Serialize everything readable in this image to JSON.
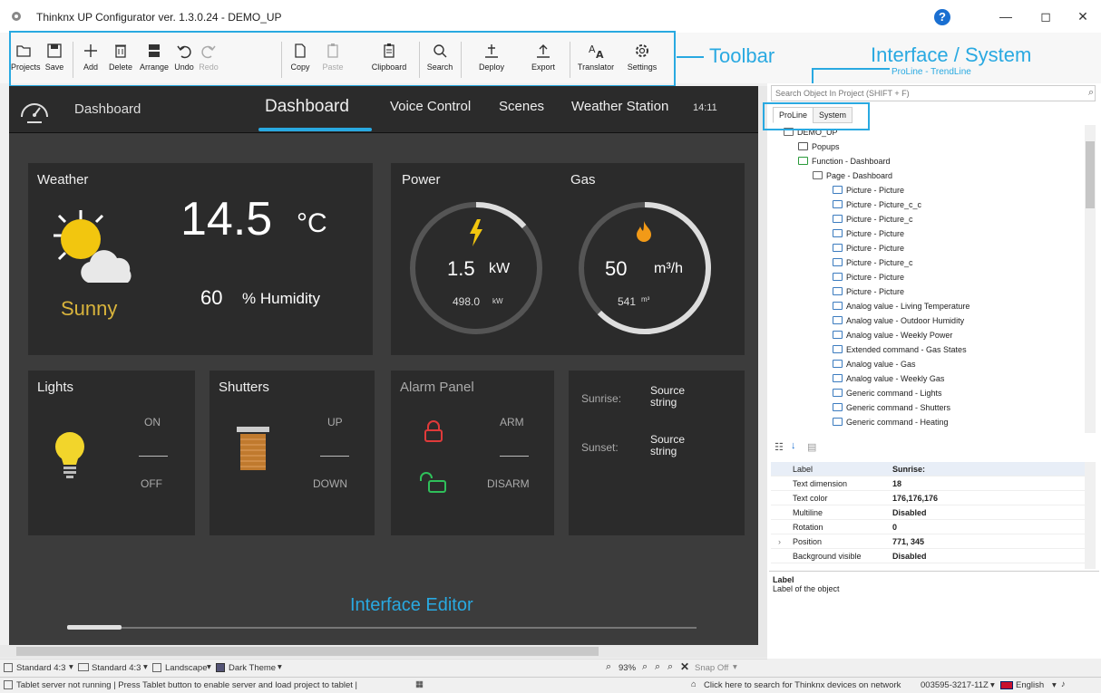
{
  "window": {
    "title": "Thinknx UP Configurator ver. 1.3.0.24 - DEMO_UP",
    "help": "?",
    "minimize": "—",
    "maximize": "◻",
    "close": "✕"
  },
  "toolbar": {
    "items": [
      {
        "label": "Projects",
        "icon": "folder-icon"
      },
      {
        "label": "Save",
        "icon": "save-icon"
      },
      {
        "label": "Add",
        "icon": "plus-icon"
      },
      {
        "label": "Delete",
        "icon": "trash-icon"
      },
      {
        "label": "Arrange",
        "icon": "arrange-icon"
      },
      {
        "label": "Undo",
        "icon": "undo-icon"
      },
      {
        "label": "Redo",
        "icon": "redo-icon"
      },
      {
        "label": "Copy",
        "icon": "copy-icon"
      },
      {
        "label": "Paste",
        "icon": "paste-icon"
      },
      {
        "label": "Clipboard",
        "icon": "clipboard-icon"
      },
      {
        "label": "Search",
        "icon": "search-icon"
      },
      {
        "label": "Deploy",
        "icon": "deploy-icon"
      },
      {
        "label": "Export",
        "icon": "export-icon"
      },
      {
        "label": "Translator",
        "icon": "translator-icon"
      },
      {
        "label": "Settings",
        "icon": "gear-icon"
      }
    ]
  },
  "annotations": {
    "toolbar": "Toolbar",
    "interface_system": "Interface / System",
    "proline_trendline": "ProLine - TrendLine",
    "interface_editor": "Interface Editor"
  },
  "editor": {
    "nav_left": "Dashboard",
    "tabs": [
      "Dashboard",
      "Voice Control",
      "Scenes",
      "Weather Station"
    ],
    "time": "14:11",
    "weather": {
      "title": "Weather",
      "temp": "14.5",
      "unit": "°C",
      "condition": "Sunny",
      "humidity_value": "60",
      "humidity_label": "% Humidity"
    },
    "power": {
      "title": "Power",
      "value": "1.5",
      "unit": "kW",
      "total": "498.0",
      "total_unit": "kW"
    },
    "gas": {
      "title": "Gas",
      "value": "50",
      "unit": "m³/h",
      "total": "541",
      "total_unit": "m³"
    },
    "lights": {
      "title": "Lights",
      "on": "ON",
      "off": "OFF"
    },
    "shutters": {
      "title": "Shutters",
      "up": "UP",
      "down": "DOWN"
    },
    "alarm": {
      "title": "Alarm Panel",
      "arm": "ARM",
      "disarm": "DISARM"
    },
    "sun": {
      "sunrise": "Sunrise:",
      "sunset": "Sunset:",
      "sunrise_value": "Source string",
      "sunset_value": "Source string"
    }
  },
  "status1": {
    "resolution1": "Standard 4:3",
    "resolution2": "Standard 4:3",
    "orientation": "Landscape",
    "theme": "Dark Theme",
    "zoom": "93%",
    "snap": "Snap Off"
  },
  "status2": {
    "left": "Tablet server not running | Press Tablet button to enable server and load project to tablet |",
    "right": "Click here to search for Thinknx devices on network",
    "serial": "003595-3217-11Z",
    "language": "English"
  },
  "panel": {
    "search_placeholder": "Search Object In Project (SHIFT + F)",
    "tabs": [
      "ProLine",
      "System"
    ],
    "tree": [
      "DEMO_UP",
      "Popups",
      "Function - Dashboard",
      "Page - Dashboard",
      "Picture - Picture",
      "Picture - Picture_c_c",
      "Picture - Picture_c",
      "Picture - Picture",
      "Picture - Picture",
      "Picture - Picture_c",
      "Picture - Picture",
      "Picture - Picture",
      "Analog value - Living Temperature",
      "Analog value - Outdoor Humidity",
      "Analog value - Weekly Power",
      "Extended command - Gas States",
      "Analog value - Gas",
      "Analog value - Weekly Gas",
      "Generic command - Lights",
      "Generic command - Shutters",
      "Generic command - Heating"
    ],
    "props": [
      {
        "k": "Label",
        "v": "Sunrise:"
      },
      {
        "k": "Text dimension",
        "v": "18"
      },
      {
        "k": "Text color",
        "v": "176,176,176"
      },
      {
        "k": "Multiline",
        "v": "Disabled"
      },
      {
        "k": "Rotation",
        "v": "0"
      },
      {
        "k": "Position",
        "v": "771, 345"
      },
      {
        "k": "Background visible",
        "v": "Disabled"
      }
    ],
    "desc_title": "Label",
    "desc": "Label of the object"
  }
}
